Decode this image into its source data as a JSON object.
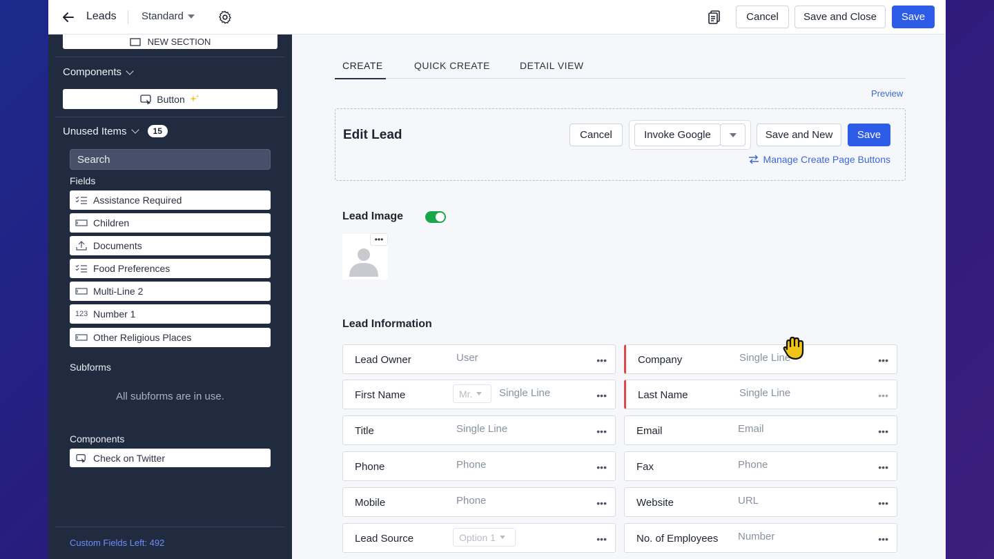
{
  "header": {
    "module_title": "Leads",
    "layout_name": "Standard",
    "cancel_label": "Cancel",
    "save_close_label": "Save and Close",
    "save_label": "Save"
  },
  "sidebar": {
    "new_section_label": "NEW SECTION",
    "components_heading": "Components",
    "button_component_label": "Button",
    "unused_heading": "Unused Items",
    "unused_count": "15",
    "search_placeholder": "Search",
    "fields_label": "Fields",
    "fields": [
      {
        "label": "Assistance Required",
        "icon": "checklist-icon"
      },
      {
        "label": "Children",
        "icon": "single-line-icon"
      },
      {
        "label": "Documents",
        "icon": "upload-icon"
      },
      {
        "label": "Food Preferences",
        "icon": "checklist-icon"
      },
      {
        "label": "Multi-Line 2",
        "icon": "single-line-icon"
      },
      {
        "label": "Number 1",
        "icon": "number-icon"
      },
      {
        "label": "Other Religious Places",
        "icon": "single-line-icon"
      }
    ],
    "number_icon_text": "123",
    "subforms_label": "Subforms",
    "subforms_note": "All subforms are in use.",
    "components_label": "Components",
    "twitter_component_label": "Check on Twitter",
    "custom_fields_left": "Custom Fields Left: 492"
  },
  "main": {
    "tabs": [
      "CREATE",
      "QUICK CREATE",
      "DETAIL VIEW"
    ],
    "active_tab": "CREATE",
    "preview_label": "Preview",
    "edit_title": "Edit Lead",
    "edit_cancel": "Cancel",
    "invoke_google": "Invoke Google",
    "save_new": "Save and New",
    "edit_save": "Save",
    "manage_buttons": "Manage Create Page Buttons",
    "lead_image_label": "Lead Image",
    "lead_image_enabled": true,
    "more_glyph": "•••",
    "section_title": "Lead Information",
    "fields_left": [
      {
        "label": "Lead Owner",
        "type": "User"
      },
      {
        "label": "First Name",
        "type": "Single Line",
        "select": "Mr."
      },
      {
        "label": "Title",
        "type": "Single Line"
      },
      {
        "label": "Phone",
        "type": "Phone"
      },
      {
        "label": "Mobile",
        "type": "Phone"
      },
      {
        "label": "Lead Source",
        "type": "",
        "select": "Option 1"
      }
    ],
    "fields_right": [
      {
        "label": "Company",
        "type": "Single Line",
        "required": true
      },
      {
        "label": "Last Name",
        "type": "Single Line",
        "required": true
      },
      {
        "label": "Email",
        "type": "Email"
      },
      {
        "label": "Fax",
        "type": "Phone"
      },
      {
        "label": "Website",
        "type": "URL"
      },
      {
        "label": "No. of Employees",
        "type": "Number"
      }
    ]
  },
  "colors": {
    "primary": "#2d5ce8",
    "sidebar_bg": "#212b40",
    "toggle_on": "#1aa64a",
    "required_marker": "#e04646",
    "link": "#3e67d6"
  }
}
